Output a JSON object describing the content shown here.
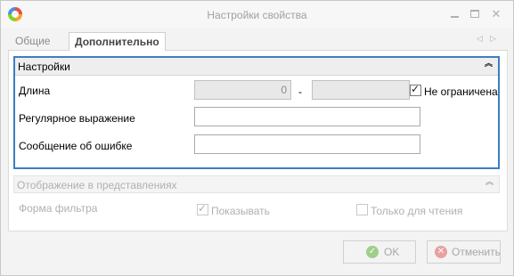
{
  "window": {
    "title": "Настройки свойства"
  },
  "tabs": [
    {
      "label": "Общие",
      "active": false
    },
    {
      "label": "Дополнительно",
      "active": true
    }
  ],
  "settings_group": {
    "title": "Настройки",
    "length": {
      "label": "Длина",
      "min_value": "0",
      "separator": "-",
      "max_value": "",
      "unlimited_label": "Не ограничена",
      "unlimited_checked": true
    },
    "regex": {
      "label": "Регулярное выражение",
      "value": ""
    },
    "error_message": {
      "label": "Сообщение об ошибке",
      "value": ""
    }
  },
  "display_group": {
    "title": "Отображение в представлениях",
    "filter_form": {
      "label": "Форма фильтра",
      "show_label": "Показывать",
      "show_checked": true,
      "readonly_label": "Только для чтения",
      "readonly_checked": false
    }
  },
  "footer": {
    "ok_label": "OK",
    "cancel_label": "Отменить"
  },
  "colors": {
    "accent_border": "#3b7dc4",
    "ok_icon": "#9fcf8a",
    "cancel_icon": "#e8a0a0"
  },
  "icons": {
    "app": "app-logo-icon",
    "minimize": "minimize-icon",
    "maximize": "maximize-icon",
    "close": "close-icon",
    "collapse": "chevrons-up-icon",
    "ok": "check-circle-icon",
    "cancel": "x-circle-icon"
  }
}
